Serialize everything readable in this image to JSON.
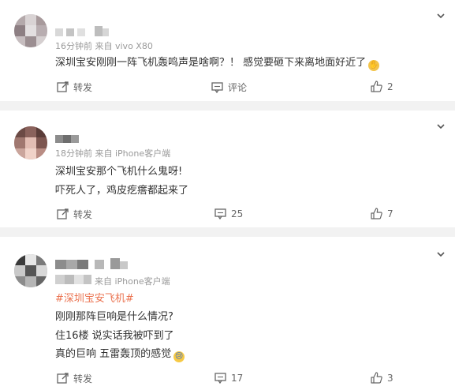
{
  "comments": [
    {
      "meta": "16分钟前  来自 vivo X80",
      "lines": [
        "深圳宝安刚刚一阵飞机轰鸣声是啥啊？！ 感觉要砸下来离地面好近了"
      ],
      "emoji_icon": "pray-icon",
      "actions": {
        "repost": "转发",
        "comment": "评论",
        "like": "2"
      }
    },
    {
      "meta": "18分钟前  来自 iPhone客户端",
      "lines": [
        "深圳宝安那个飞机什么鬼呀!",
        "吓死人了，鸡皮疙瘩都起来了"
      ],
      "actions": {
        "repost": "转发",
        "comment": "25",
        "like": "7"
      }
    },
    {
      "meta": "来自 iPhone客户端",
      "tag": "#深圳宝安飞机#",
      "lines": [
        "刚刚那阵巨响是什么情况?",
        "住16楼 说实话我被吓到了",
        "真的巨响 五雷轰顶的感觉"
      ],
      "emoji_icon": "crying-face-icon",
      "actions": {
        "repost": "转发",
        "comment": "17",
        "like": "3"
      }
    }
  ],
  "colors": {
    "tag": "#eb7350",
    "background": "#f2f2f2",
    "meta": "#9a9a9a"
  }
}
